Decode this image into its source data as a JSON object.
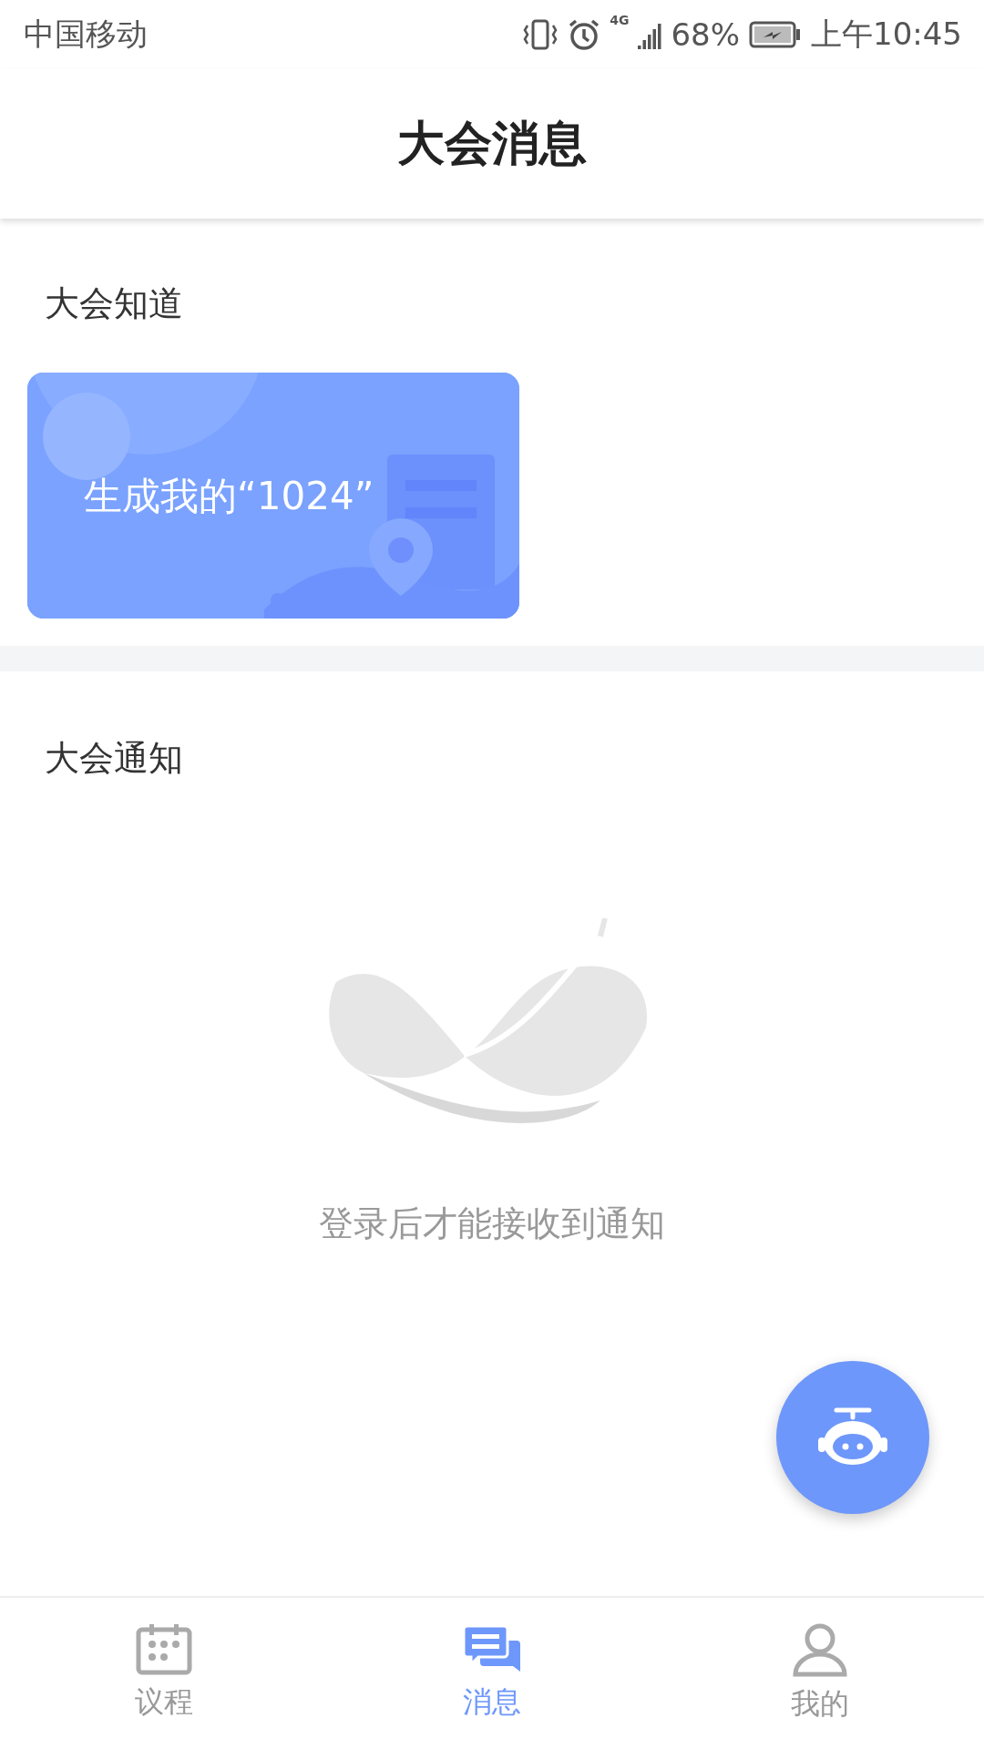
{
  "status_bar": {
    "carrier": "中国移动",
    "network": "4G",
    "battery": "68%",
    "time": "上午10:45"
  },
  "header": {
    "title": "大会消息"
  },
  "sections": [
    {
      "kind": "cards",
      "title": "大会知道",
      "cards": [
        {
          "label": "生成我的“1024”"
        }
      ]
    },
    {
      "kind": "empty",
      "title": "大会通知",
      "message": "登录后才能接收到通知"
    }
  ],
  "tabs": [
    {
      "label": "议程",
      "kind": "calendar",
      "selected": false
    },
    {
      "label": "消息",
      "kind": "chat",
      "selected": true
    },
    {
      "label": "我的",
      "kind": "user",
      "selected": false
    }
  ]
}
